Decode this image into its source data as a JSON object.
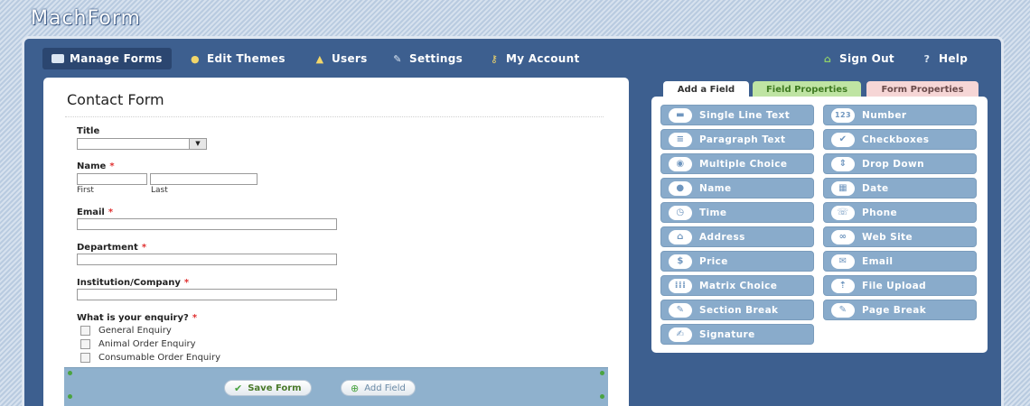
{
  "app": {
    "logo": "MachForm"
  },
  "nav": {
    "left": [
      {
        "label": "Manage Forms",
        "icon": "form-icon",
        "active": true
      },
      {
        "label": "Edit Themes",
        "icon": "palette-icon"
      },
      {
        "label": "Users",
        "icon": "user-icon"
      },
      {
        "label": "Settings",
        "icon": "wrench-icon"
      },
      {
        "label": "My Account",
        "icon": "key-icon"
      }
    ],
    "right": [
      {
        "label": "Sign Out",
        "icon": "sign-out-icon"
      },
      {
        "label": "Help",
        "icon": "help-icon"
      }
    ]
  },
  "form": {
    "title": "Contact Form",
    "fields": {
      "title": {
        "label": "Title"
      },
      "name": {
        "label": "Name",
        "required": "*",
        "first": "First",
        "last": "Last"
      },
      "email": {
        "label": "Email",
        "required": "*"
      },
      "department": {
        "label": "Department",
        "required": "*"
      },
      "institution": {
        "label": "Institution/Company",
        "required": "*"
      },
      "enquiry": {
        "label": "What is your enquiry?",
        "required": "*",
        "options": [
          "General Enquiry",
          "Animal Order Enquiry",
          "Consumable Order Enquiry"
        ]
      }
    },
    "actions": {
      "save": "Save Form",
      "add": "Add Field"
    }
  },
  "tabs": [
    "Add a Field",
    "Field Properties",
    "Form Properties"
  ],
  "field_buttons": {
    "left": [
      {
        "label": "Single Line Text",
        "icon": "text-line-icon"
      },
      {
        "label": "Paragraph Text",
        "icon": "paragraph-icon"
      },
      {
        "label": "Multiple Choice",
        "icon": "radio-icon"
      },
      {
        "label": "Name",
        "icon": "person-icon"
      },
      {
        "label": "Time",
        "icon": "clock-icon"
      },
      {
        "label": "Address",
        "icon": "house-icon"
      },
      {
        "label": "Price",
        "icon": "dollar-icon"
      },
      {
        "label": "Matrix Choice",
        "icon": "matrix-icon"
      },
      {
        "label": "Section Break",
        "icon": "section-break-icon"
      },
      {
        "label": "Signature",
        "icon": "signature-icon"
      }
    ],
    "right": [
      {
        "label": "Number",
        "icon": "number-icon"
      },
      {
        "label": "Checkboxes",
        "icon": "checkbox-icon"
      },
      {
        "label": "Drop Down",
        "icon": "dropdown-icon"
      },
      {
        "label": "Date",
        "icon": "calendar-icon"
      },
      {
        "label": "Phone",
        "icon": "phone-icon"
      },
      {
        "label": "Web Site",
        "icon": "link-icon"
      },
      {
        "label": "Email",
        "icon": "envelope-icon"
      },
      {
        "label": "File Upload",
        "icon": "upload-icon"
      },
      {
        "label": "Page Break",
        "icon": "page-break-icon"
      }
    ]
  },
  "colors": {
    "accent": "#3d5f8f",
    "button": "#89abcb",
    "required": "#e03030"
  }
}
